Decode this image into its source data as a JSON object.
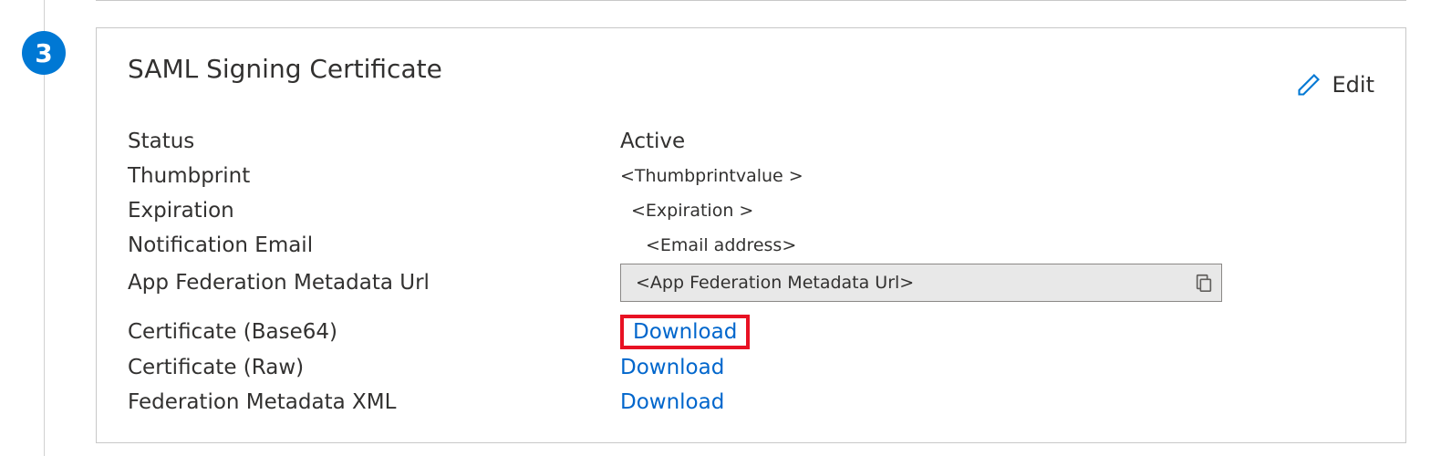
{
  "step": {
    "number": "3"
  },
  "card": {
    "title": "SAML Signing Certificate",
    "edit_label": "Edit"
  },
  "labels": {
    "status": "Status",
    "thumbprint": "Thumbprint",
    "expiration": "Expiration",
    "notification_email": "Notification Email",
    "metadata_url": "App Federation Metadata Url",
    "cert_base64": "Certificate (Base64)",
    "cert_raw": "Certificate (Raw)",
    "fed_metadata_xml": "Federation Metadata XML"
  },
  "values": {
    "status": "Active",
    "thumbprint": "<Thumbprintvalue >",
    "expiration": "<Expiration >",
    "notification_email": "<Email address>",
    "metadata_url": "<App Federation  Metadata Url>",
    "download_base64": "Download",
    "download_raw": "Download",
    "download_xml": "Download"
  }
}
